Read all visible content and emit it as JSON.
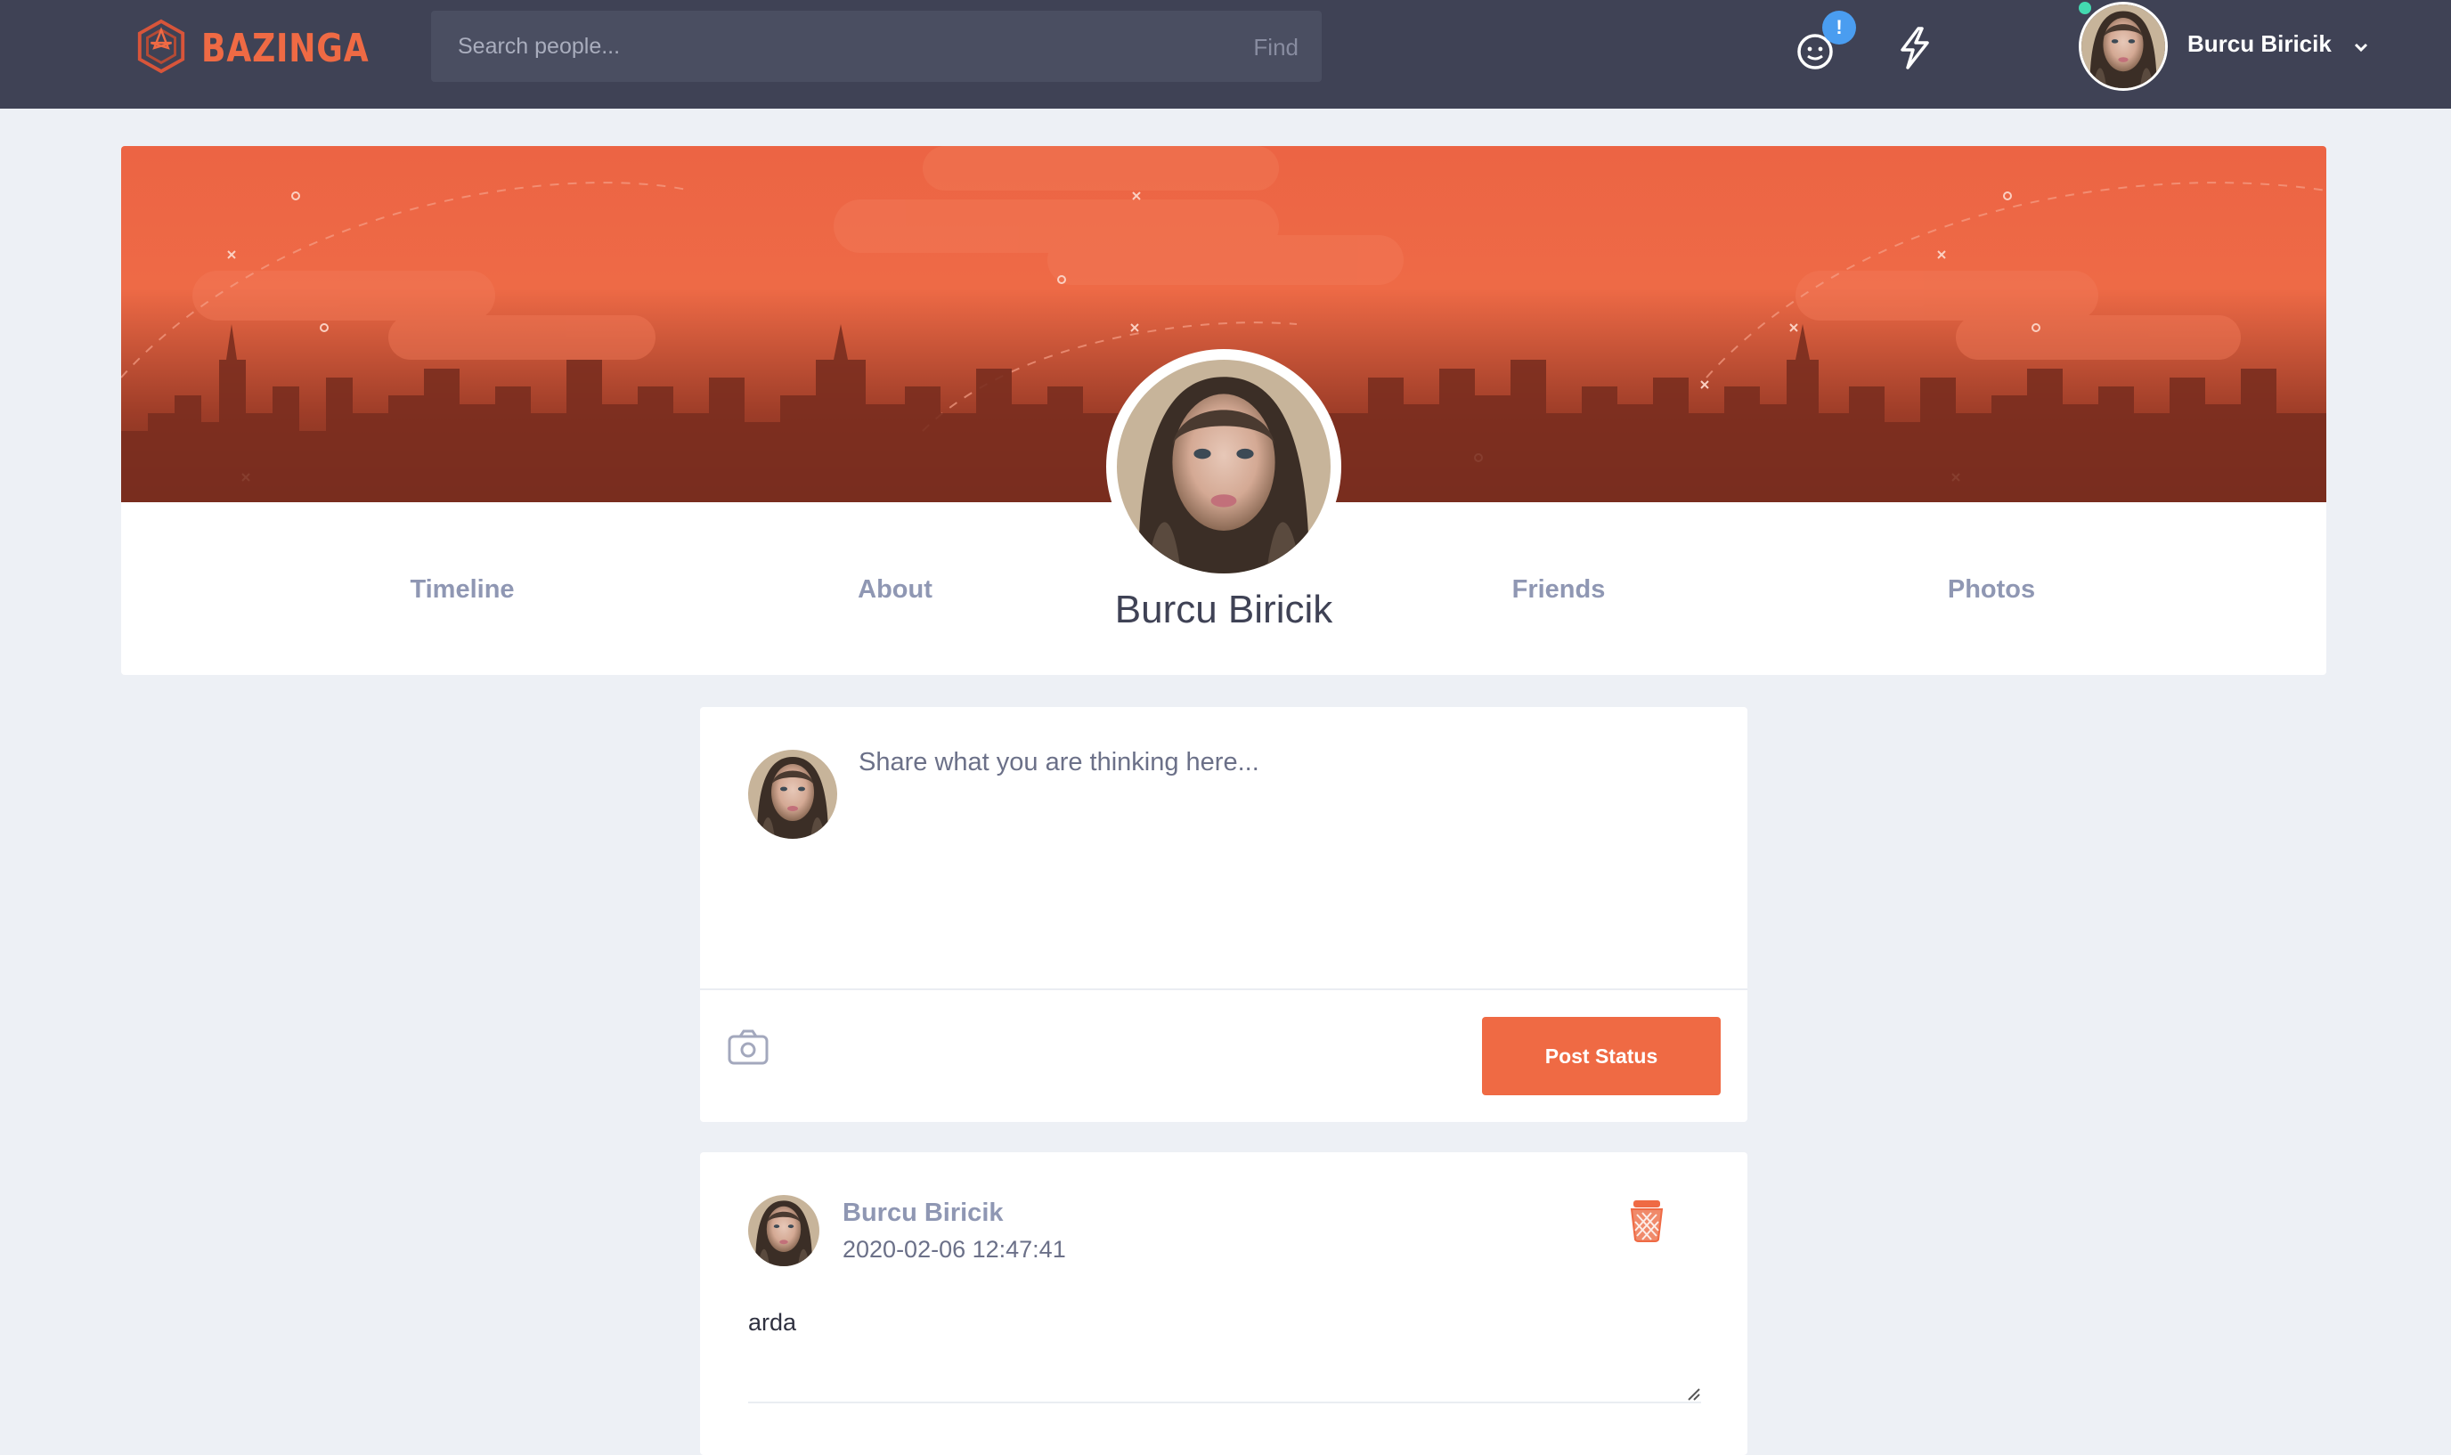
{
  "app": {
    "brand": "BAZINGA",
    "search": {
      "placeholder": "Search people...",
      "find_label": "Find"
    },
    "notifications_badge": "!",
    "user": {
      "name": "Burcu Biricik",
      "online": true
    }
  },
  "profile": {
    "name": "Burcu Biricik",
    "tabs": [
      "Timeline",
      "About",
      "Friends",
      "Photos"
    ]
  },
  "composer": {
    "placeholder": "Share what you are thinking here...",
    "post_button": "Post Status"
  },
  "posts": [
    {
      "author": "Burcu Biricik",
      "timestamp": "2020-02-06 12:47:41",
      "text": "arda"
    }
  ],
  "colors": {
    "accent": "#ef6a44",
    "nav_bg": "#3f4255",
    "page_bg": "#edf0f5",
    "badge": "#4a9df0",
    "online": "#43d9b0",
    "tab_text": "#8f97b3"
  },
  "icons": {
    "logo": "bazinga-logo-icon",
    "messages": "smiley-chat-icon",
    "activity": "lightning-icon",
    "dropdown": "chevron-down-icon",
    "photo": "camera-icon",
    "delete": "trash-icon"
  }
}
